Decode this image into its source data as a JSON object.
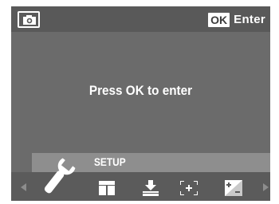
{
  "header": {
    "mode_icon": "camera-icon",
    "ok_badge": "OK",
    "enter_label": "Enter"
  },
  "main": {
    "message": "Press OK to enter"
  },
  "menu": {
    "selected_label": "SETUP",
    "icons": [
      "wrench-icon",
      "frames-icon",
      "download-icon",
      "focus-frame-icon",
      "exposure-icon"
    ],
    "nav": [
      "arrow-left-icon",
      "arrow-right-icon"
    ]
  },
  "colors": {
    "screen": "#6b6b6b",
    "topbar": "#595959",
    "highlight": "#8e8e8e",
    "iconbar": "#5b5b5b",
    "text": "#ffffff"
  }
}
